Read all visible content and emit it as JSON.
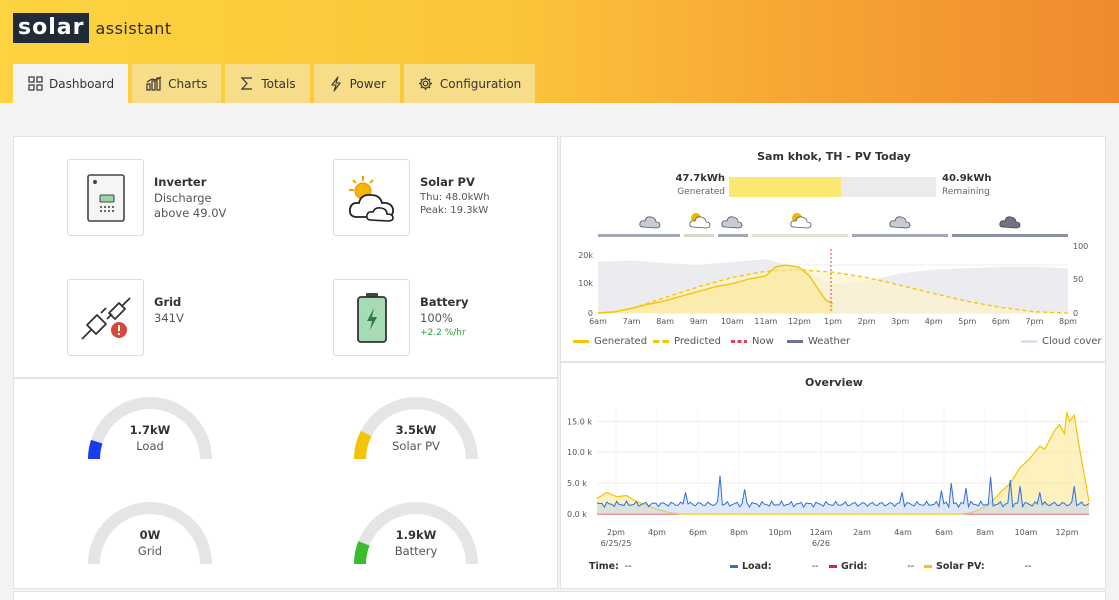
{
  "app": {
    "logo_main": "solar",
    "logo_sub": "assistant"
  },
  "tabs": [
    {
      "label": "Dashboard",
      "icon": "grid-icon"
    },
    {
      "label": "Charts",
      "icon": "bar-chart-icon"
    },
    {
      "label": "Totals",
      "icon": "sigma-icon"
    },
    {
      "label": "Power",
      "icon": "lightning-icon"
    },
    {
      "label": "Configuration",
      "icon": "gear-icon"
    }
  ],
  "devices": {
    "inverter": {
      "title": "Inverter",
      "line1": "Discharge",
      "line2": "above 49.0V"
    },
    "solar": {
      "title": "Solar PV",
      "line1": "Thu: 48.0kWh",
      "line2": "Peak: 19.3kW"
    },
    "grid": {
      "title": "Grid",
      "line1": "341V"
    },
    "battery": {
      "title": "Battery",
      "line1": "100%",
      "line2": "+2.2 %/hr"
    }
  },
  "gauges": [
    {
      "value": "1.7kW",
      "label": "Load",
      "level": 0.1,
      "color": "#1a3cf0"
    },
    {
      "value": "3.5kW",
      "label": "Solar PV",
      "level": 0.15,
      "color": "#f5c400"
    },
    {
      "value": "0W",
      "label": "Grid",
      "level": 0.0,
      "color": "#e2e2e2"
    },
    {
      "value": "1.9kW",
      "label": "Battery",
      "level": 0.12,
      "color": "#3dbb2f"
    }
  ],
  "pv_today": {
    "title": "Sam khok, TH - PV Today",
    "generated_value": "47.7kWh",
    "generated_label": "Generated",
    "remaining_value": "40.9kWh",
    "remaining_label": "Remaining",
    "generated_fraction": 0.54,
    "legend": [
      "Generated",
      "Predicted",
      "Now",
      "Weather",
      "Cloud cover"
    ],
    "x_ticks": [
      "6am",
      "7am",
      "8am",
      "9am",
      "10am",
      "11am",
      "12pm",
      "1pm",
      "2pm",
      "3pm",
      "4pm",
      "5pm",
      "6pm",
      "7pm",
      "8pm"
    ],
    "y_left_ticks": [
      "20k",
      "10k",
      "0"
    ],
    "y_right_ticks": [
      "100",
      "50",
      "0"
    ]
  },
  "overview": {
    "title": "Overview",
    "y_ticks": [
      "15.0 k",
      "10.0 k",
      "5.0 k",
      "0.0 k"
    ],
    "x_ticks": [
      "2pm",
      "4pm",
      "6pm",
      "8pm",
      "10pm",
      "12am",
      "2am",
      "4am",
      "6am",
      "8am",
      "10am",
      "12pm"
    ],
    "x_subticks": {
      "2pm": "6/25/25",
      "12am": "6/26"
    },
    "footer": {
      "time_label": "Time:",
      "time_value": "--",
      "load_label": "Load:",
      "load_value": "--",
      "grid_label": "Grid:",
      "grid_value": "--",
      "solar_label": "Solar PV:",
      "solar_value": "--"
    }
  },
  "colors": {
    "load": "#2f6fd6",
    "grid": "#d8253a",
    "solar": "#f5c400",
    "weather": "#6b7493",
    "cloud": "#e0e0ea"
  }
}
